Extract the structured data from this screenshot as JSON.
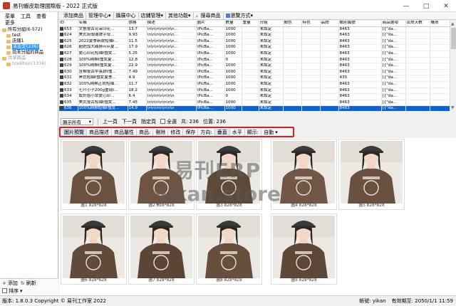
{
  "window": {
    "title": "易刊蝦皮助理國際版 - 2022 正式版",
    "controls": [
      "—",
      "□",
      "✕"
    ]
  },
  "left": {
    "menu": [
      "菜單",
      "工具",
      "查看"
    ],
    "more": "更多",
    "tree": [
      {
        "label": "所有分組(6-572)",
        "level": 0,
        "selected": false,
        "gray": false
      },
      {
        "label": "test",
        "level": 1,
        "selected": false,
        "gray": false
      },
      {
        "label": "店鋪1",
        "level": 1,
        "selected": false,
        "gray": false
      },
      {
        "label": "未設定(236)",
        "level": 1,
        "selected": true,
        "gray": false
      },
      {
        "label": "尚未分組的商品",
        "level": 1,
        "selected": false,
        "gray": false
      },
      {
        "label": "共享商品",
        "level": 0,
        "selected": false,
        "gray": true
      },
      {
        "label": "tradition(1336)",
        "level": 1,
        "selected": false,
        "gray": true
      }
    ],
    "add_label": "添加",
    "refresh_label": "刷新",
    "sort_label": "排序"
  },
  "toolbar": {
    "items": [
      "添加商品",
      "管理中心",
      "攝展中心",
      "店鋪管理",
      "其他功能",
      "搜尋商品",
      "瀏覽方式"
    ]
  },
  "table": {
    "headers": [
      "ID",
      "名稱",
      "價格",
      "描述",
      "圖片",
      "數量",
      "重量",
      "分組",
      "顏色",
      "特色",
      "品牌",
      "類別編號",
      "商品選項",
      "出貨天數",
      "購買"
    ],
    "rows": [
      [
        "653",
        "文藝復古花朵印花...",
        "13.7",
        "\\n\\n\\n\\n\\n\\n\\n...",
        "\\PicBa...",
        "1000",
        "",
        "未設定",
        "",
        "",
        "",
        "8463",
        "[{\"da...",
        "",
        ""
      ],
      [
        "624",
        "美式街頭潮牌字母...",
        "9.93",
        "\\n\\n\\n\\n\\n\\n\\n...",
        "\\PicBa...",
        "1000",
        "",
        "未設定",
        "",
        "",
        "",
        "8463",
        "[{\"da...",
        "",
        ""
      ],
      [
        "625",
        "2022夏季新款短袖t...",
        "11.5",
        "\\n\\n\\n\\n\\n\\n\\n...",
        "\\PicBa...",
        "1000",
        "",
        "未設定",
        "",
        "",
        "",
        "8463",
        "[{\"da...",
        "",
        ""
      ],
      [
        "626",
        "超肥加大碼胖mm夏...",
        "17.9",
        "\\n\\n\\n\\n\\n\\n\\n...",
        "\\PicBa...",
        "1000",
        "",
        "未設定",
        "",
        "",
        "",
        "8463",
        "[{\"da...",
        "",
        ""
      ],
      [
        "627",
        "愛心印花短袖t恤女...",
        "5.25",
        "\\n\\n\\n\\n\\n\\n\\n",
        "\\PicBa...",
        "1000",
        "",
        "未設定",
        "",
        "",
        "",
        "8463",
        "[{\"da...",
        "",
        ""
      ],
      [
        "628",
        "100%純棉t恤女夏...",
        "12.8",
        "\\n\\n\\n\\n\\n\\n\\n...",
        "\\PicBa...",
        "0",
        "",
        "未設定",
        "",
        "",
        "",
        "8463",
        "[{\"da...",
        "",
        ""
      ],
      [
        "629",
        "100%純棉t恤女夏...",
        "22.9",
        "\\n\\n\\n\\n\\n\\n\\n...",
        "\\PicBa...",
        "1000",
        "",
        "未設定",
        "",
        "",
        "",
        "8463",
        "[{\"da...",
        "",
        ""
      ],
      [
        "630",
        "含棉復古中長款t恤...",
        "7.49",
        "\\n\\n\\n\\n\\n\\n\\n",
        "\\PicBa...",
        "1000",
        "",
        "未設定",
        "",
        "",
        "",
        "8463",
        "[{\"da...",
        "",
        ""
      ],
      [
        "631",
        "黑色短袖t恤女夏季...",
        "4.9",
        "\\n\\n\\n\\n\\n\\n\\n",
        "\\PicBa...",
        "1000",
        "",
        "未設定",
        "",
        "",
        "",
        "435",
        "[{\"da...",
        "",
        ""
      ],
      [
        "632",
        "100%純棉正肩短袖...",
        "11.7",
        "\\n\\n\\n\\n\\n\\n\\n",
        "\\PicBa...",
        "1000",
        "",
        "未設定",
        "",
        "",
        "",
        "8463",
        "[{\"da...",
        "",
        ""
      ],
      [
        "633",
        "七只小子200g重磅t...",
        "18.2",
        "\\n\\n\\n\\n\\n\\n\\n",
        "\\PicBa...",
        "1000",
        "",
        "未設定",
        "",
        "",
        "",
        "8463",
        "[{\"da...",
        "",
        ""
      ],
      [
        "634",
        "設計感小眾愛心印...",
        "6.4",
        "\\n\\n\\n\\n\\n\\n\\n",
        "\\PicBa...",
        "0",
        "",
        "未設定",
        "",
        "",
        "",
        "8463",
        "[{\"da...",
        "",
        ""
      ],
      [
        "635",
        "美式復古短袖t恤女...",
        "7.45",
        "\\n\\n\\n\\n\\n\\n\\n",
        "\\PicBa...",
        "1000",
        "",
        "未設定",
        "",
        "",
        "",
        "8463",
        "[{\"da...",
        "",
        ""
      ],
      [
        "636",
        "100%純棉短袖t恤女...",
        "14.9",
        "\\n\\n\\n\\n\\n\\n\\n",
        "\\PicBa...",
        "1000",
        "",
        "未設定",
        "",
        "",
        "",
        "8463",
        "[{\"da...",
        "",
        ""
      ]
    ],
    "selected_row": 13
  },
  "filter": {
    "select_value": "顯示所有",
    "prev": "上一頁",
    "next": "下一頁",
    "jump": "指定頁",
    "select_all": "全選",
    "total": "共: 236",
    "position": "位置: 236"
  },
  "imgbar": {
    "items": [
      "圖片預覽",
      "商品描述",
      "商品屬性",
      "商品:",
      "刪除",
      "修改",
      "保存",
      "方向:",
      "垂直",
      "水平",
      "顯示:",
      "自動"
    ]
  },
  "gallery": {
    "photos": [
      {
        "caption": "圖1 828*828",
        "shirt": "#6b5140"
      },
      {
        "caption": "圖2 828*828",
        "shirt": "#6f5443"
      },
      {
        "caption": "圖3 828*828",
        "shirt": "#5e4838"
      },
      {
        "caption": "圖4 828*828",
        "shirt": "#735746"
      },
      {
        "caption": "圖5 828*828",
        "shirt": "#6a503f"
      },
      {
        "caption": "圖6 828*828",
        "shirt": "#624a3a"
      },
      {
        "caption": "圖7 828*828",
        "shirt": "#5d4536"
      },
      {
        "caption": "圖8 828*828",
        "shirt": "#684e3d"
      },
      {
        "caption": "圖9 828*828",
        "shirt": "#5f4737"
      }
    ],
    "watermark_line1": "易刊ERP",
    "watermark_line2": "yikan.store"
  },
  "status": {
    "version": "版本: 1.8.0.3 Copyright © 易刊工作室 2022",
    "account": "帳號: yikan",
    "expiry": "有效期至: 2050/1/1 11:59"
  }
}
